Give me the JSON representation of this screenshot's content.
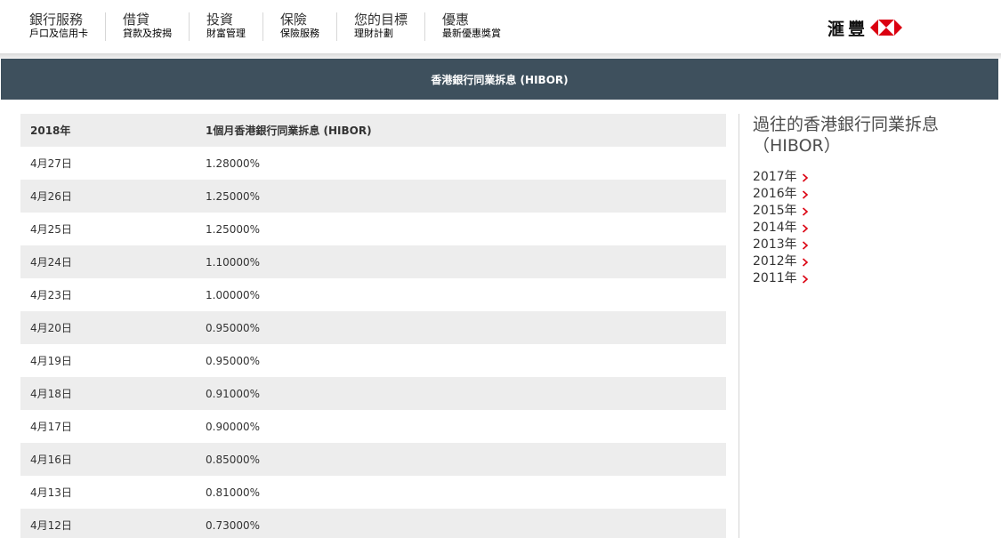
{
  "nav": {
    "items": [
      {
        "title": "銀行服務",
        "sub": "戶口及信用卡"
      },
      {
        "title": "借貸",
        "sub": "貸款及按揭"
      },
      {
        "title": "投資",
        "sub": "財富管理"
      },
      {
        "title": "保險",
        "sub": "保險服務"
      },
      {
        "title": "您的目標",
        "sub": "理財計劃"
      },
      {
        "title": "優惠",
        "sub": "最新優惠獎賞"
      }
    ],
    "logo_text": "滙豐",
    "brand_colors": {
      "red": "#db0011",
      "white": "#ffffff"
    }
  },
  "banner": {
    "title": "香港銀行同業拆息 (HIBOR)",
    "background": "#3e505d"
  },
  "table": {
    "header": {
      "date": "2018年",
      "rate": "1個月香港銀行同業拆息 (HIBOR)"
    },
    "rows": [
      {
        "date": "4月27日",
        "rate": "1.28000%"
      },
      {
        "date": "4月26日",
        "rate": "1.25000%"
      },
      {
        "date": "4月25日",
        "rate": "1.25000%"
      },
      {
        "date": "4月24日",
        "rate": "1.10000%"
      },
      {
        "date": "4月23日",
        "rate": "1.00000%"
      },
      {
        "date": "4月20日",
        "rate": "0.95000%"
      },
      {
        "date": "4月19日",
        "rate": "0.95000%"
      },
      {
        "date": "4月18日",
        "rate": "0.91000%"
      },
      {
        "date": "4月17日",
        "rate": "0.90000%"
      },
      {
        "date": "4月16日",
        "rate": "0.85000%"
      },
      {
        "date": "4月13日",
        "rate": "0.81000%"
      },
      {
        "date": "4月12日",
        "rate": "0.73000%"
      }
    ]
  },
  "sidebar": {
    "title": "過往的香港銀行同業拆息（HIBOR）",
    "years": [
      "2017年",
      "2016年",
      "2015年",
      "2014年",
      "2013年",
      "2012年",
      "2011年"
    ],
    "chevron_color": "#db0011"
  }
}
